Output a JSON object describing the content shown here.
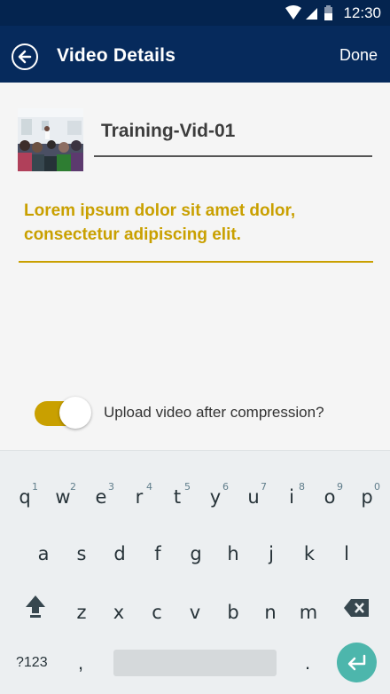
{
  "status_bar": {
    "time": "12:30",
    "icons": [
      "wifi-icon",
      "signal-icon",
      "battery-icon"
    ]
  },
  "app_bar": {
    "title": "Video Details",
    "done_label": "Done"
  },
  "video": {
    "name": "Training-Vid-01"
  },
  "description": {
    "value": "Lorem ipsum dolor sit amet dolor, consectetur adipiscing elit."
  },
  "upload_toggle": {
    "label": "Upload video after compression?",
    "on": true
  },
  "keyboard": {
    "row1": [
      {
        "key": "q",
        "hint": "1"
      },
      {
        "key": "w",
        "hint": "2"
      },
      {
        "key": "e",
        "hint": "3"
      },
      {
        "key": "r",
        "hint": "4"
      },
      {
        "key": "t",
        "hint": "5"
      },
      {
        "key": "y",
        "hint": "6"
      },
      {
        "key": "u",
        "hint": "7"
      },
      {
        "key": "i",
        "hint": "8"
      },
      {
        "key": "o",
        "hint": "9"
      },
      {
        "key": "p",
        "hint": "0"
      }
    ],
    "row2": [
      "a",
      "s",
      "d",
      "f",
      "g",
      "h",
      "j",
      "k",
      "l"
    ],
    "row3": [
      "z",
      "x",
      "c",
      "v",
      "b",
      "n",
      "m"
    ],
    "symbols_label": "?123",
    "comma": ",",
    "period": "."
  },
  "colors": {
    "app_bar": "#062a5c",
    "status_bar": "#04244f",
    "accent": "#c9a000",
    "enter_key": "#4db6ac"
  }
}
